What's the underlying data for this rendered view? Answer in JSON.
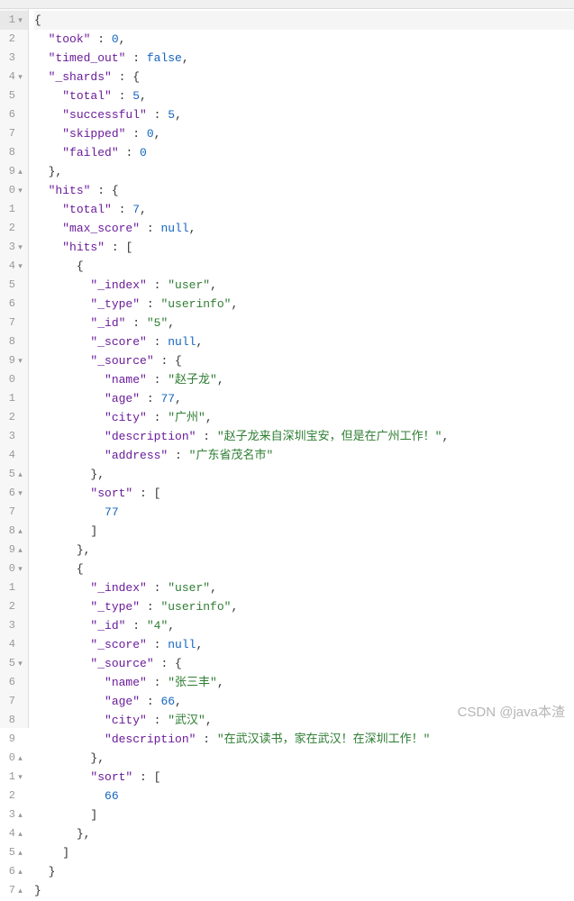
{
  "watermark": "CSDN @java本渣",
  "lines": [
    {
      "n": "1",
      "f": "▾",
      "cur": true,
      "ind": 0,
      "tok": [
        {
          "c": "punct",
          "t": "{"
        }
      ]
    },
    {
      "n": "2",
      "f": "",
      "ind": 1,
      "tok": [
        {
          "c": "key",
          "t": "\"took\""
        },
        {
          "c": "colon",
          "t": " : "
        },
        {
          "c": "num",
          "t": "0"
        },
        {
          "c": "punct",
          "t": ","
        }
      ]
    },
    {
      "n": "3",
      "f": "",
      "ind": 1,
      "tok": [
        {
          "c": "key",
          "t": "\"timed_out\""
        },
        {
          "c": "colon",
          "t": " : "
        },
        {
          "c": "bool",
          "t": "false"
        },
        {
          "c": "punct",
          "t": ","
        }
      ]
    },
    {
      "n": "4",
      "f": "▾",
      "ind": 1,
      "tok": [
        {
          "c": "key",
          "t": "\"_shards\""
        },
        {
          "c": "colon",
          "t": " : "
        },
        {
          "c": "punct",
          "t": "{"
        }
      ]
    },
    {
      "n": "5",
      "f": "",
      "ind": 2,
      "tok": [
        {
          "c": "key",
          "t": "\"total\""
        },
        {
          "c": "colon",
          "t": " : "
        },
        {
          "c": "num",
          "t": "5"
        },
        {
          "c": "punct",
          "t": ","
        }
      ]
    },
    {
      "n": "6",
      "f": "",
      "ind": 2,
      "tok": [
        {
          "c": "key",
          "t": "\"successful\""
        },
        {
          "c": "colon",
          "t": " : "
        },
        {
          "c": "num",
          "t": "5"
        },
        {
          "c": "punct",
          "t": ","
        }
      ]
    },
    {
      "n": "7",
      "f": "",
      "ind": 2,
      "tok": [
        {
          "c": "key",
          "t": "\"skipped\""
        },
        {
          "c": "colon",
          "t": " : "
        },
        {
          "c": "num",
          "t": "0"
        },
        {
          "c": "punct",
          "t": ","
        }
      ]
    },
    {
      "n": "8",
      "f": "",
      "ind": 2,
      "tok": [
        {
          "c": "key",
          "t": "\"failed\""
        },
        {
          "c": "colon",
          "t": " : "
        },
        {
          "c": "num",
          "t": "0"
        }
      ]
    },
    {
      "n": "9",
      "f": "▴",
      "ind": 1,
      "tok": [
        {
          "c": "punct",
          "t": "},"
        }
      ]
    },
    {
      "n": "0",
      "f": "▾",
      "ind": 1,
      "tok": [
        {
          "c": "key",
          "t": "\"hits\""
        },
        {
          "c": "colon",
          "t": " : "
        },
        {
          "c": "punct",
          "t": "{"
        }
      ]
    },
    {
      "n": "1",
      "f": "",
      "ind": 2,
      "tok": [
        {
          "c": "key",
          "t": "\"total\""
        },
        {
          "c": "colon",
          "t": " : "
        },
        {
          "c": "num",
          "t": "7"
        },
        {
          "c": "punct",
          "t": ","
        }
      ]
    },
    {
      "n": "2",
      "f": "",
      "ind": 2,
      "tok": [
        {
          "c": "key",
          "t": "\"max_score\""
        },
        {
          "c": "colon",
          "t": " : "
        },
        {
          "c": "null",
          "t": "null"
        },
        {
          "c": "punct",
          "t": ","
        }
      ]
    },
    {
      "n": "3",
      "f": "▾",
      "ind": 2,
      "tok": [
        {
          "c": "key",
          "t": "\"hits\""
        },
        {
          "c": "colon",
          "t": " : "
        },
        {
          "c": "punct",
          "t": "["
        }
      ]
    },
    {
      "n": "4",
      "f": "▾",
      "ind": 3,
      "tok": [
        {
          "c": "punct",
          "t": "{"
        }
      ]
    },
    {
      "n": "5",
      "f": "",
      "ind": 4,
      "tok": [
        {
          "c": "key",
          "t": "\"_index\""
        },
        {
          "c": "colon",
          "t": " : "
        },
        {
          "c": "str",
          "t": "\"user\""
        },
        {
          "c": "punct",
          "t": ","
        }
      ]
    },
    {
      "n": "6",
      "f": "",
      "ind": 4,
      "tok": [
        {
          "c": "key",
          "t": "\"_type\""
        },
        {
          "c": "colon",
          "t": " : "
        },
        {
          "c": "str",
          "t": "\"userinfo\""
        },
        {
          "c": "punct",
          "t": ","
        }
      ]
    },
    {
      "n": "7",
      "f": "",
      "ind": 4,
      "tok": [
        {
          "c": "key",
          "t": "\"_id\""
        },
        {
          "c": "colon",
          "t": " : "
        },
        {
          "c": "str",
          "t": "\"5\""
        },
        {
          "c": "punct",
          "t": ","
        }
      ]
    },
    {
      "n": "8",
      "f": "",
      "ind": 4,
      "tok": [
        {
          "c": "key",
          "t": "\"_score\""
        },
        {
          "c": "colon",
          "t": " : "
        },
        {
          "c": "null",
          "t": "null"
        },
        {
          "c": "punct",
          "t": ","
        }
      ]
    },
    {
      "n": "9",
      "f": "▾",
      "ind": 4,
      "tok": [
        {
          "c": "key",
          "t": "\"_source\""
        },
        {
          "c": "colon",
          "t": " : "
        },
        {
          "c": "punct",
          "t": "{"
        }
      ]
    },
    {
      "n": "0",
      "f": "",
      "ind": 5,
      "tok": [
        {
          "c": "key",
          "t": "\"name\""
        },
        {
          "c": "colon",
          "t": " : "
        },
        {
          "c": "str",
          "t": "\"赵子龙\""
        },
        {
          "c": "punct",
          "t": ","
        }
      ]
    },
    {
      "n": "1",
      "f": "",
      "ind": 5,
      "tok": [
        {
          "c": "key",
          "t": "\"age\""
        },
        {
          "c": "colon",
          "t": " : "
        },
        {
          "c": "num",
          "t": "77"
        },
        {
          "c": "punct",
          "t": ","
        }
      ]
    },
    {
      "n": "2",
      "f": "",
      "ind": 5,
      "tok": [
        {
          "c": "key",
          "t": "\"city\""
        },
        {
          "c": "colon",
          "t": " : "
        },
        {
          "c": "str",
          "t": "\"广州\""
        },
        {
          "c": "punct",
          "t": ","
        }
      ]
    },
    {
      "n": "3",
      "f": "",
      "ind": 5,
      "tok": [
        {
          "c": "key",
          "t": "\"description\""
        },
        {
          "c": "colon",
          "t": " : "
        },
        {
          "c": "str",
          "t": "\"赵子龙来自深圳宝安，但是在广州工作！\""
        },
        {
          "c": "punct",
          "t": ","
        }
      ]
    },
    {
      "n": "4",
      "f": "",
      "ind": 5,
      "tok": [
        {
          "c": "key",
          "t": "\"address\""
        },
        {
          "c": "colon",
          "t": " : "
        },
        {
          "c": "str",
          "t": "\"广东省茂名市\""
        }
      ]
    },
    {
      "n": "5",
      "f": "▴",
      "ind": 4,
      "tok": [
        {
          "c": "punct",
          "t": "},"
        }
      ]
    },
    {
      "n": "6",
      "f": "▾",
      "ind": 4,
      "tok": [
        {
          "c": "key",
          "t": "\"sort\""
        },
        {
          "c": "colon",
          "t": " : "
        },
        {
          "c": "punct",
          "t": "["
        }
      ]
    },
    {
      "n": "7",
      "f": "",
      "ind": 5,
      "tok": [
        {
          "c": "num",
          "t": "77"
        }
      ]
    },
    {
      "n": "8",
      "f": "▴",
      "ind": 4,
      "tok": [
        {
          "c": "punct",
          "t": "]"
        }
      ]
    },
    {
      "n": "9",
      "f": "▴",
      "ind": 3,
      "tok": [
        {
          "c": "punct",
          "t": "},"
        }
      ]
    },
    {
      "n": "0",
      "f": "▾",
      "ind": 3,
      "tok": [
        {
          "c": "punct",
          "t": "{"
        }
      ]
    },
    {
      "n": "1",
      "f": "",
      "ind": 4,
      "tok": [
        {
          "c": "key",
          "t": "\"_index\""
        },
        {
          "c": "colon",
          "t": " : "
        },
        {
          "c": "str",
          "t": "\"user\""
        },
        {
          "c": "punct",
          "t": ","
        }
      ]
    },
    {
      "n": "2",
      "f": "",
      "ind": 4,
      "tok": [
        {
          "c": "key",
          "t": "\"_type\""
        },
        {
          "c": "colon",
          "t": " : "
        },
        {
          "c": "str",
          "t": "\"userinfo\""
        },
        {
          "c": "punct",
          "t": ","
        }
      ]
    },
    {
      "n": "3",
      "f": "",
      "ind": 4,
      "tok": [
        {
          "c": "key",
          "t": "\"_id\""
        },
        {
          "c": "colon",
          "t": " : "
        },
        {
          "c": "str",
          "t": "\"4\""
        },
        {
          "c": "punct",
          "t": ","
        }
      ]
    },
    {
      "n": "4",
      "f": "",
      "ind": 4,
      "tok": [
        {
          "c": "key",
          "t": "\"_score\""
        },
        {
          "c": "colon",
          "t": " : "
        },
        {
          "c": "null",
          "t": "null"
        },
        {
          "c": "punct",
          "t": ","
        }
      ]
    },
    {
      "n": "5",
      "f": "▾",
      "ind": 4,
      "tok": [
        {
          "c": "key",
          "t": "\"_source\""
        },
        {
          "c": "colon",
          "t": " : "
        },
        {
          "c": "punct",
          "t": "{"
        }
      ]
    },
    {
      "n": "6",
      "f": "",
      "ind": 5,
      "tok": [
        {
          "c": "key",
          "t": "\"name\""
        },
        {
          "c": "colon",
          "t": " : "
        },
        {
          "c": "str",
          "t": "\"张三丰\""
        },
        {
          "c": "punct",
          "t": ","
        }
      ]
    },
    {
      "n": "7",
      "f": "",
      "ind": 5,
      "tok": [
        {
          "c": "key",
          "t": "\"age\""
        },
        {
          "c": "colon",
          "t": " : "
        },
        {
          "c": "num",
          "t": "66"
        },
        {
          "c": "punct",
          "t": ","
        }
      ]
    },
    {
      "n": "8",
      "f": "",
      "ind": 5,
      "tok": [
        {
          "c": "key",
          "t": "\"city\""
        },
        {
          "c": "colon",
          "t": " : "
        },
        {
          "c": "str",
          "t": "\"武汉\""
        },
        {
          "c": "punct",
          "t": ","
        }
      ]
    },
    {
      "n": "9",
      "f": "",
      "ind": 5,
      "tok": [
        {
          "c": "key",
          "t": "\"description\""
        },
        {
          "c": "colon",
          "t": " : "
        },
        {
          "c": "str",
          "t": "\"在武汉读书，家在武汉！在深圳工作！\""
        }
      ]
    },
    {
      "n": "0",
      "f": "▴",
      "ind": 4,
      "tok": [
        {
          "c": "punct",
          "t": "},"
        }
      ]
    },
    {
      "n": "1",
      "f": "▾",
      "ind": 4,
      "tok": [
        {
          "c": "key",
          "t": "\"sort\""
        },
        {
          "c": "colon",
          "t": " : "
        },
        {
          "c": "punct",
          "t": "["
        }
      ]
    },
    {
      "n": "2",
      "f": "",
      "ind": 5,
      "tok": [
        {
          "c": "num",
          "t": "66"
        }
      ]
    },
    {
      "n": "3",
      "f": "▴",
      "ind": 4,
      "tok": [
        {
          "c": "punct",
          "t": "]"
        }
      ]
    },
    {
      "n": "4",
      "f": "▴",
      "ind": 3,
      "tok": [
        {
          "c": "punct",
          "t": "},"
        }
      ]
    },
    {
      "n": "5",
      "f": "▴",
      "ind": 2,
      "tok": [
        {
          "c": "punct",
          "t": "]"
        }
      ]
    },
    {
      "n": "6",
      "f": "▴",
      "ind": 1,
      "tok": [
        {
          "c": "punct",
          "t": "}"
        }
      ]
    },
    {
      "n": "7",
      "f": "▴",
      "ind": 0,
      "tok": [
        {
          "c": "punct",
          "t": "}"
        }
      ]
    }
  ]
}
